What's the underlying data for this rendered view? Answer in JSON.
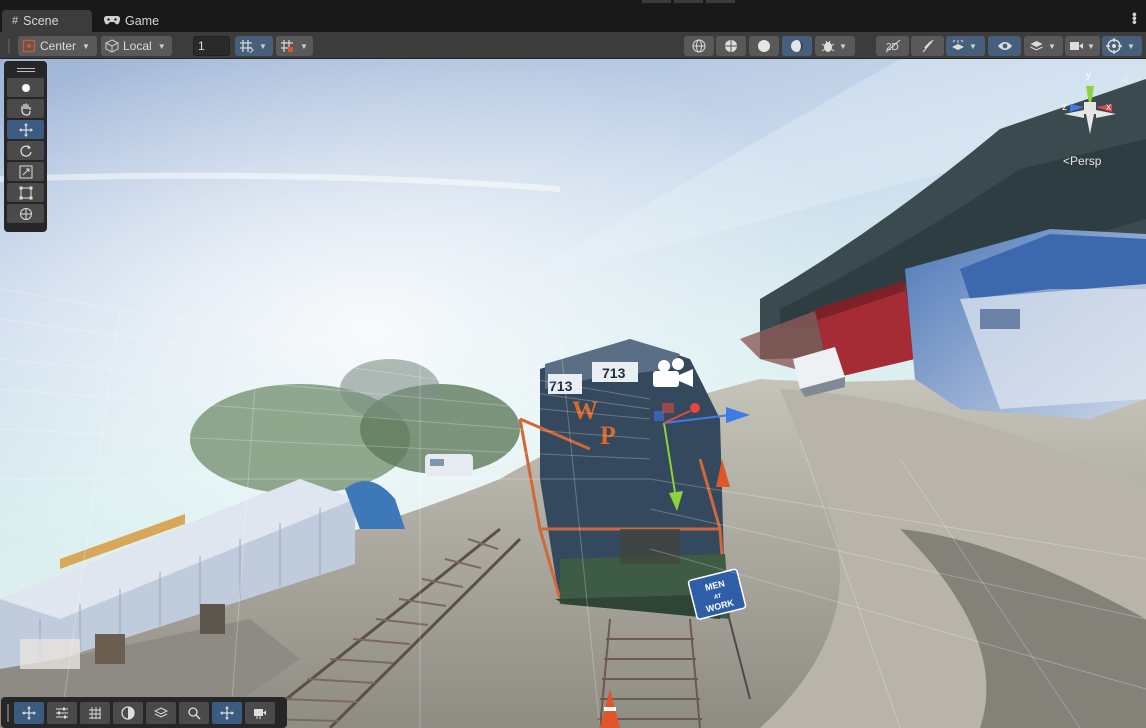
{
  "tabs": {
    "scene": {
      "label": "Scene",
      "icon": "grid-icon"
    },
    "game": {
      "label": "Game",
      "icon": "gamepad-icon"
    }
  },
  "toolbar": {
    "pivot_mode": "Center",
    "pivot_rotation": "Local",
    "grid_size_value": "1"
  },
  "gizmo": {
    "projection_label": "Persp",
    "axes": {
      "x": "x",
      "y": "y",
      "z": "z"
    },
    "colors": {
      "x": "#e8473d",
      "y": "#8dd43a",
      "z": "#3d7ce8"
    }
  },
  "scene": {
    "locomotive_number": "713",
    "locomotive_letters": [
      "W",
      "P"
    ],
    "sign_lines": [
      "MEN",
      "AT",
      "WORK"
    ]
  },
  "colors": {
    "toolbar_bg": "#3c3c3c",
    "button_bg": "#595959",
    "selected_bg": "#46607c",
    "tab_active_bg": "#3c3c3c",
    "palette_bg": "#262626"
  }
}
